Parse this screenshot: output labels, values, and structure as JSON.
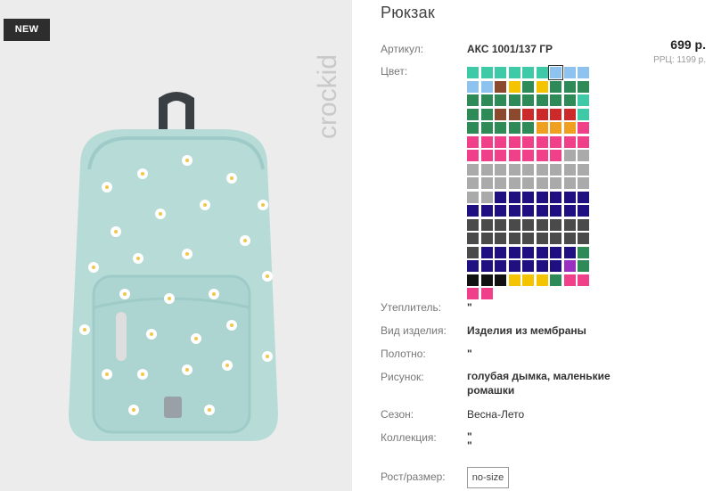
{
  "product": {
    "badge": "NEW",
    "brand": "crockid",
    "title": "Рюкзак",
    "price": "699 р.",
    "rrp": "РРЦ: 1199 р."
  },
  "details": {
    "article_label": "Артикул:",
    "article_value": "АКС 1001/137 ГР",
    "color_label": "Цвет:",
    "insulation_label": "Утеплитель:",
    "insulation_value": "\"",
    "type_label": "Вид изделия:",
    "type_value": "Изделия из мембраны",
    "fabric_label": "Полотно:",
    "fabric_value": "\"",
    "pattern_label": "Рисунок:",
    "pattern_value_1": "голубая дымка, маленькие",
    "pattern_value_2": "ромашки",
    "season_label": "Сезон:",
    "season_value": "Весна-Лето",
    "collection_label": "Коллекция:",
    "collection_value_1": "\"",
    "collection_value_2": "\"",
    "size_label": "Рост/размер:",
    "size_value": "no-size"
  },
  "color_swatches": {
    "selected_index": 6,
    "rows": [
      [
        "#3ec9a7",
        "#3ec9a7",
        "#3ec9a7",
        "#3ec9a7",
        "#3ec9a7",
        "#3ec9a7",
        "#8ec3ef",
        "#8ec3ef",
        "#8ec3ef"
      ],
      [
        "#8ec3ef",
        "#8ec3ef",
        "#8b4a2e",
        "#f5c400",
        "#2e8b57",
        "#f5c400",
        "#2e8b57",
        "#2e8b57",
        "#2e8b57"
      ],
      [
        "#2e8b57",
        "#2e8b57",
        "#2e8b57",
        "#2e8b57",
        "#2e8b57",
        "#2e8b57",
        "#2e8b57",
        "#2e8b57",
        "#3ec9a7"
      ],
      [
        "#2e8b57",
        "#2e8b57",
        "#8b4a2e",
        "#8b4a2e",
        "#cc2a2a",
        "#cc2a2a",
        "#cc2a2a",
        "#cc2a2a",
        "#3ec9a7"
      ],
      [
        "#2e8b57",
        "#2e8b57",
        "#2e8b57",
        "#2e8b57",
        "#2e8b57",
        "#f0a020",
        "#f0a020",
        "#f0a020",
        "#f0408a"
      ],
      [
        "#f0408a",
        "#f0408a",
        "#f0408a",
        "#f0408a",
        "#f0408a",
        "#f0408a",
        "#f0408a",
        "#f0408a",
        "#f0408a"
      ],
      [
        "#f0408a",
        "#f0408a",
        "#f0408a",
        "#f0408a",
        "#f0408a",
        "#f0408a",
        "#f0408a",
        "#aaaaaa",
        "#aaaaaa"
      ],
      [
        "#aaaaaa",
        "#aaaaaa",
        "#aaaaaa",
        "#aaaaaa",
        "#aaaaaa",
        "#aaaaaa",
        "#aaaaaa",
        "#aaaaaa",
        "#aaaaaa"
      ],
      [
        "#aaaaaa",
        "#aaaaaa",
        "#aaaaaa",
        "#aaaaaa",
        "#aaaaaa",
        "#aaaaaa",
        "#aaaaaa",
        "#aaaaaa",
        "#aaaaaa"
      ],
      [
        "#aaaaaa",
        "#aaaaaa",
        "#1e1080",
        "#1e1080",
        "#1e1080",
        "#1e1080",
        "#1e1080",
        "#1e1080",
        "#1e1080"
      ],
      [
        "#1e1080",
        "#1e1080",
        "#1e1080",
        "#1e1080",
        "#1e1080",
        "#1e1080",
        "#1e1080",
        "#1e1080",
        "#1e1080"
      ],
      [
        "#4a4a4a",
        "#4a4a4a",
        "#4a4a4a",
        "#4a4a4a",
        "#4a4a4a",
        "#4a4a4a",
        "#4a4a4a",
        "#4a4a4a",
        "#4a4a4a"
      ],
      [
        "#4a4a4a",
        "#4a4a4a",
        "#4a4a4a",
        "#4a4a4a",
        "#4a4a4a",
        "#4a4a4a",
        "#4a4a4a",
        "#4a4a4a",
        "#4a4a4a"
      ],
      [
        "#4a4a4a",
        "#1e1080",
        "#1e1080",
        "#1e1080",
        "#1e1080",
        "#1e1080",
        "#1e1080",
        "#1e1080",
        "#2e8b57"
      ],
      [
        "#1e1080",
        "#1e1080",
        "#1e1080",
        "#1e1080",
        "#1e1080",
        "#1e1080",
        "#1e1080",
        "#9a30c0",
        "#2e8b57"
      ],
      [
        "#111111",
        "#111111",
        "#111111",
        "#f5c400",
        "#f5c400",
        "#f5c400",
        "#2e8b57",
        "#f0408a",
        "#f0408a"
      ],
      [
        "#f0408a",
        "#f0408a"
      ]
    ]
  }
}
